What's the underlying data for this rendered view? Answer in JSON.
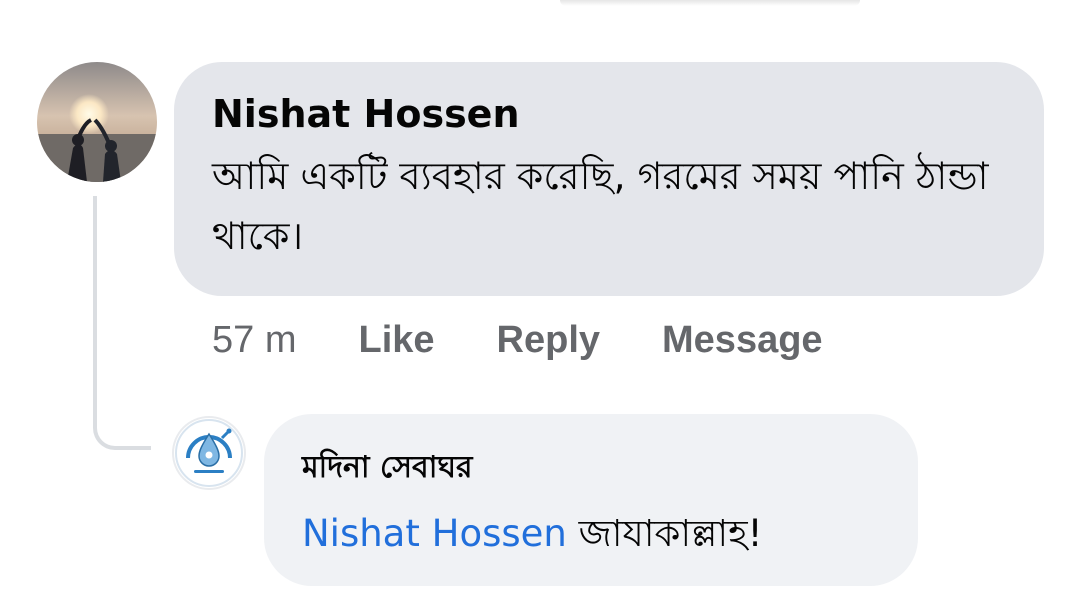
{
  "comment": {
    "author": "Nishat Hossen",
    "text": "আমি  একটি ব্যবহার করেছি, গরমের সময় পানি ঠান্ডা থাকে।",
    "timestamp": "57 m",
    "actions": {
      "like": "Like",
      "reply": "Reply",
      "message": "Message"
    },
    "avatar_icon": "profile-photo-sunset"
  },
  "reply": {
    "author": "মদিনা সেবাঘর",
    "mention": "Nishat Hossen",
    "text": "জাযাকাল্লাহ!",
    "avatar_icon": "page-logo-water-drop"
  },
  "colors": {
    "bubble_main": "#e4e6eb",
    "bubble_reply": "#f0f2f5",
    "mention": "#216fdb",
    "meta": "#65676b"
  }
}
